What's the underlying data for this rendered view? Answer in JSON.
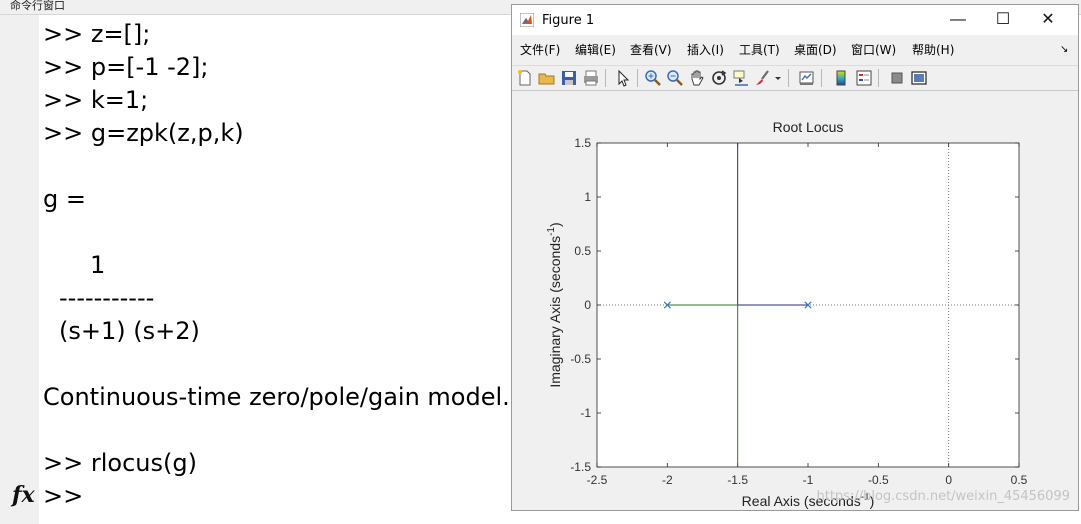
{
  "command_window": {
    "title": "命令行窗口",
    "lines": [
      ">> z=[];",
      ">> p=[-1 -2];",
      ">> k=1;",
      ">> g=zpk(z,p,k)",
      "g =",
      "1",
      "-----------",
      "(s+1) (s+2)",
      "Continuous-time zero/pole/gain model.",
      ">> rlocus(g)",
      ">>"
    ],
    "fx_label": "fx"
  },
  "figure": {
    "title": "Figure 1",
    "window_buttons": [
      "—",
      "☐",
      "✕"
    ],
    "menu": [
      "文件(F)",
      "编辑(E)",
      "查看(V)",
      "插入(I)",
      "工具(T)",
      "桌面(D)",
      "窗口(W)",
      "帮助(H)"
    ],
    "menu_expand_icon": "↘",
    "toolbar_icons": [
      "new-figure-icon",
      "open-file-icon",
      "save-icon",
      "print-icon",
      "select-arrow-icon",
      "zoom-in-icon",
      "zoom-out-icon",
      "pan-hand-icon",
      "rotate-3d-icon",
      "data-cursor-icon",
      "brush-icon",
      "brush-dropdown-icon",
      "link-plot-icon",
      "colorbar-icon",
      "legend-icon",
      "hide-plot-tools-icon",
      "show-plot-tools-icon"
    ],
    "watermark": "https://blog.csdn.net/weixin_45456099"
  },
  "chart_data": {
    "type": "line",
    "title": "Root Locus",
    "xlabel": "Real Axis (seconds",
    "xlabel_sup": "-1",
    "xlabel_end": ")",
    "ylabel": "Imaginary Axis (seconds",
    "ylabel_sup": "-1",
    "ylabel_end": ")",
    "xlim": [
      -2.5,
      0.5
    ],
    "ylim": [
      -1.5,
      1.5
    ],
    "xticks": [
      -2.5,
      -2,
      -1.5,
      -1,
      -0.5,
      0,
      0.5
    ],
    "xtick_labels": [
      "-2.5",
      "-2",
      "-1.5",
      "-1",
      "-0.5",
      "0",
      "0.5"
    ],
    "yticks": [
      -1.5,
      -1,
      -0.5,
      0,
      0.5,
      1,
      1.5
    ],
    "ytick_labels": [
      "-1.5",
      "-1",
      "-0.5",
      "0",
      "0.5",
      "1",
      "1.5"
    ],
    "poles": [
      [
        -2,
        0
      ],
      [
        -1,
        0
      ]
    ],
    "series": [
      {
        "color": "#2a2a8a",
        "x": [
          -1,
          -1.5,
          -1.5
        ],
        "y": [
          0,
          0,
          1.5
        ]
      },
      {
        "color": "#2a7a2a",
        "x": [
          -2,
          -1.5,
          -1.5
        ],
        "y": [
          0,
          0,
          -1.5
        ]
      }
    ],
    "pole_color": "#3a7ab8",
    "grid": false,
    "dotted_axes_color": "#555555"
  }
}
